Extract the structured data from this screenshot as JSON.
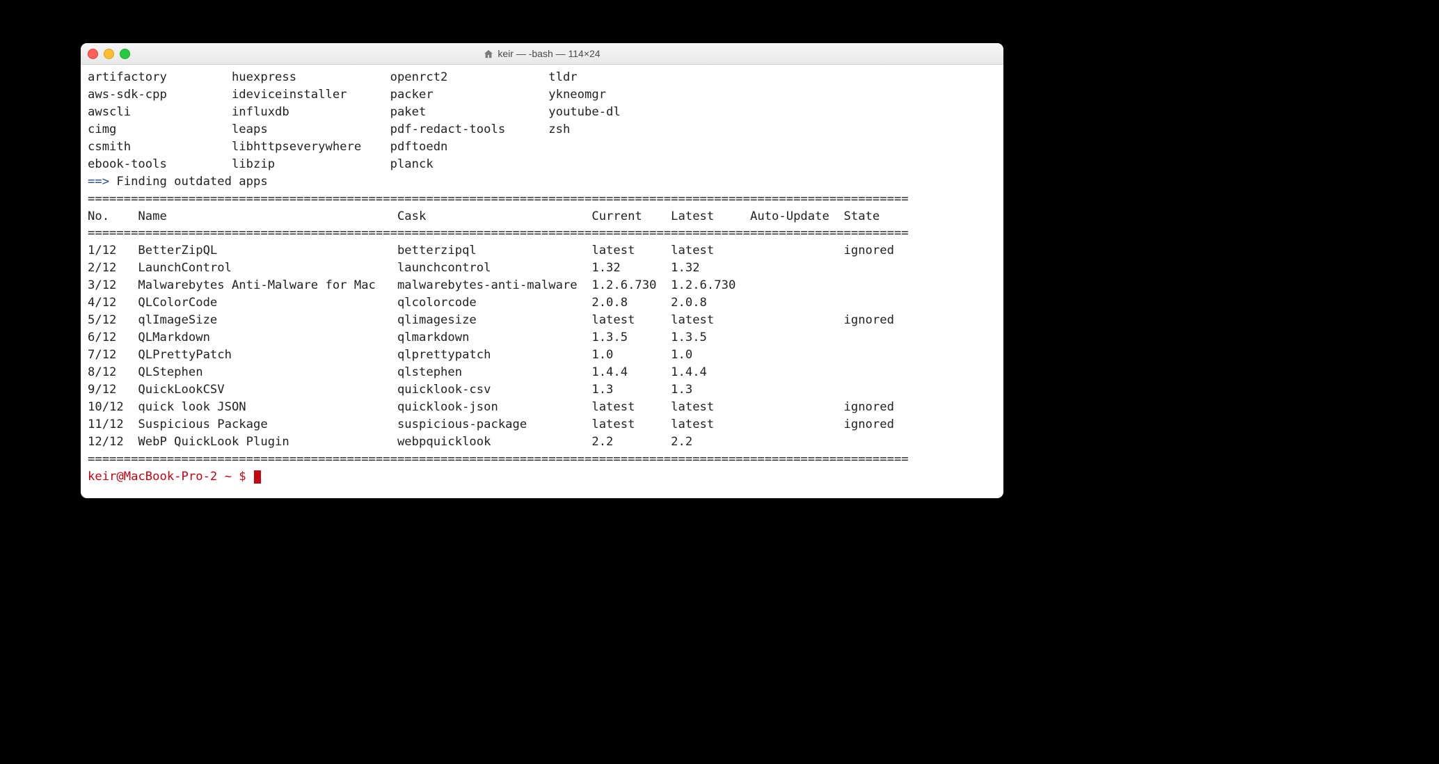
{
  "window": {
    "title": "keir — -bash — 114×24"
  },
  "packages_columns": [
    [
      "artifactory",
      "aws-sdk-cpp",
      "awscli",
      "cimg",
      "csmith",
      "ebook-tools"
    ],
    [
      "huexpress",
      "ideviceinstaller",
      "influxdb",
      "leaps",
      "libhttpseverywhere",
      "libzip"
    ],
    [
      "openrct2",
      "packer",
      "paket",
      "pdf-redact-tools",
      "pdftoedn",
      "planck"
    ],
    [
      "tldr",
      "ykneomgr",
      "youtube-dl",
      "zsh",
      "",
      ""
    ]
  ],
  "status_line": {
    "arrow": "==>",
    "text": " Finding outdated apps"
  },
  "hr": "==================================================================================================================",
  "table": {
    "header": {
      "no": "No.",
      "name": "Name",
      "cask": "Cask",
      "current": "Current",
      "latest": "Latest",
      "auto": "Auto-Update",
      "state": "State"
    },
    "rows": [
      {
        "no": "1/12",
        "name": "BetterZipQL",
        "cask": "betterzipql",
        "current": "latest",
        "latest": "latest",
        "auto": "",
        "state": "ignored"
      },
      {
        "no": "2/12",
        "name": "LaunchControl",
        "cask": "launchcontrol",
        "current": "1.32",
        "latest": "1.32",
        "auto": "",
        "state": ""
      },
      {
        "no": "3/12",
        "name": "Malwarebytes Anti-Malware for Mac",
        "cask": "malwarebytes-anti-malware",
        "current": "1.2.6.730",
        "latest": "1.2.6.730",
        "auto": "",
        "state": ""
      },
      {
        "no": "4/12",
        "name": "QLColorCode",
        "cask": "qlcolorcode",
        "current": "2.0.8",
        "latest": "2.0.8",
        "auto": "",
        "state": ""
      },
      {
        "no": "5/12",
        "name": "qlImageSize",
        "cask": "qlimagesize",
        "current": "latest",
        "latest": "latest",
        "auto": "",
        "state": "ignored"
      },
      {
        "no": "6/12",
        "name": "QLMarkdown",
        "cask": "qlmarkdown",
        "current": "1.3.5",
        "latest": "1.3.5",
        "auto": "",
        "state": ""
      },
      {
        "no": "7/12",
        "name": "QLPrettyPatch",
        "cask": "qlprettypatch",
        "current": "1.0",
        "latest": "1.0",
        "auto": "",
        "state": ""
      },
      {
        "no": "8/12",
        "name": "QLStephen",
        "cask": "qlstephen",
        "current": "1.4.4",
        "latest": "1.4.4",
        "auto": "",
        "state": ""
      },
      {
        "no": "9/12",
        "name": "QuickLookCSV",
        "cask": "quicklook-csv",
        "current": "1.3",
        "latest": "1.3",
        "auto": "",
        "state": ""
      },
      {
        "no": "10/12",
        "name": "quick look JSON",
        "cask": "quicklook-json",
        "current": "latest",
        "latest": "latest",
        "auto": "",
        "state": "ignored"
      },
      {
        "no": "11/12",
        "name": "Suspicious Package",
        "cask": "suspicious-package",
        "current": "latest",
        "latest": "latest",
        "auto": "",
        "state": "ignored"
      },
      {
        "no": "12/12",
        "name": "WebP QuickLook Plugin",
        "cask": "webpquicklook",
        "current": "2.2",
        "latest": "2.2",
        "auto": "",
        "state": ""
      }
    ]
  },
  "prompt": "keir@MacBook-Pro-2 ~ $ ",
  "col_widths": {
    "pkg0": 20,
    "pkg1": 22,
    "pkg2": 22,
    "pkg3": 20,
    "no": 7,
    "name": 36,
    "cask": 27,
    "current": 11,
    "latest": 11,
    "auto": 13,
    "state": 8
  }
}
